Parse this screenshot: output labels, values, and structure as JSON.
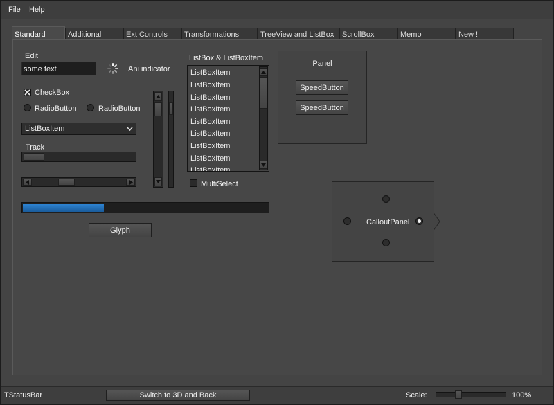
{
  "menu": {
    "file": "File",
    "help": "Help"
  },
  "tabs": [
    "Standard",
    "Additional",
    "Ext Controls",
    "Transformations",
    "TreeView and ListBox",
    "ScrollBox",
    "Memo",
    "New !"
  ],
  "standard": {
    "edit_label": "Edit",
    "edit_value": "some text",
    "ani_label": "Ani indicator",
    "checkbox_label": "CheckBox",
    "checkbox_checked": true,
    "radio1_label": "RadioButton",
    "radio2_label": "RadioButton",
    "combo_value": "ListBoxItem",
    "track_label": "Track",
    "listbox_label": "ListBox & ListBoxItem",
    "listbox_items": [
      "ListBoxItem",
      "ListBoxItem",
      "ListBoxItem",
      "ListBoxItem",
      "ListBoxItem",
      "ListBoxItem",
      "ListBoxItem",
      "ListBoxItem",
      "ListBoxItem"
    ],
    "multiselect_label": "MultiSelect",
    "progress_percent": 33,
    "glyph_button": "Glyph",
    "panel_label": "Panel",
    "speed_button_1": "SpeedButton",
    "speed_button_2": "SpeedButton",
    "callout_label": "CalloutPanel"
  },
  "status": {
    "label": "TStatusBar",
    "switch_button": "Switch to 3D and Back",
    "scale_label": "Scale:",
    "scale_value": "100%"
  },
  "colors": {
    "progress_fill": "#1f6fb8",
    "background": "#474747"
  }
}
